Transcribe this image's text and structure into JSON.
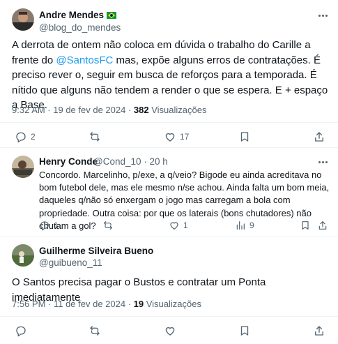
{
  "main_tweet": {
    "author_name": "Andre Mendes",
    "handle": "@blog_do_mendes",
    "text_before_mention": "A derrota de ontem não coloca em dúvida o trabalho do Carille a frente do ",
    "mention": "@SantosFC",
    "text_after_mention": " mas, expõe alguns erros de contratações. É preciso rever o, seguir em busca de reforços para a temporada. É nítido que alguns não tendem a render o que se espera. E + espaço a Base.",
    "timestamp": "9:32 AM · 19 de fev de 2024",
    "separator": " · ",
    "views_count": "382",
    "views_label": " Visualizações",
    "stats": {
      "replies": "2",
      "reposts": "",
      "likes": "17"
    }
  },
  "reply": {
    "author_name": "Henry Conde",
    "handle": "@Cond_10",
    "time": "· 20 h",
    "text": "Concordo. Marcelinho, p/exe, a q/veio? Bigode eu ainda acreditava no bom futebol dele, mas ele mesmo n/se achou. Ainda falta um bom meia, daqueles q/não só enxergam o jogo mas carregam a bola com propriedade. Outra coisa: por que os laterais (bons chutadores) não chutam a gol?",
    "stats": {
      "replies": "1",
      "reposts": "",
      "likes": "1",
      "views": "9"
    }
  },
  "third_tweet": {
    "author_name": "Guilherme Silveira Bueno",
    "handle": "@guibueno_11",
    "text": "O Santos precisa pagar o Bustos e contratar um Ponta imediatamente",
    "timestamp": "7:56 PM · 11 de fev de 2024",
    "separator": " · ",
    "views_count": "19",
    "views_label": " Visualizações"
  },
  "icons": [
    "more-icon",
    "reply-icon",
    "repost-icon",
    "like-icon",
    "views-icon",
    "bookmark-icon",
    "share-icon",
    "verified-flag-icon"
  ],
  "colors": {
    "link": "#1d9bf0",
    "secondary_text": "#536471",
    "divider": "#eff3f4",
    "brazil_green": "#009c3b",
    "brazil_yellow": "#ffdf00"
  }
}
